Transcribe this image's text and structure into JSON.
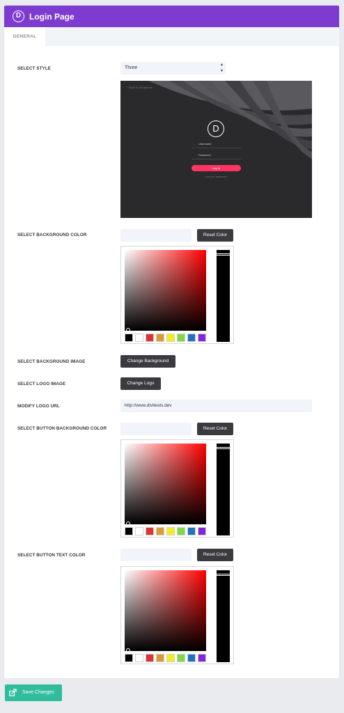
{
  "header": {
    "logo_letter": "D",
    "title": "Login Page"
  },
  "tabs": [
    {
      "label": "GENERAL",
      "active": true
    }
  ],
  "style_section": {
    "label": "SELECT STYLE",
    "selected": "Three",
    "preview": {
      "back_link": "← Back to Wordpress",
      "logo_letter": "D",
      "username_label": "Username",
      "password_label": "Password",
      "login_button": "Log In",
      "forgot_link": "Lost your password?"
    }
  },
  "bg_color": {
    "label": "SELECT BACKGROUND COLOR",
    "reset_label": "Reset Color"
  },
  "bg_image": {
    "label": "SELECT BACKGROUND IMAGE",
    "button_label": "Change Background"
  },
  "logo_image": {
    "label": "SELECT LOGO IMAGE",
    "button_label": "Change Logo"
  },
  "logo_url": {
    "label": "MODIFY LOGO URL",
    "value": "http://www.divitests.dev"
  },
  "btn_bg_color": {
    "label": "SELECT BUTTON BACKGROUND COLOR",
    "reset_label": "Reset Color"
  },
  "btn_text_color": {
    "label": "SELECT BUTTON TEXT COLOR",
    "reset_label": "Reset Color"
  },
  "swatch_colors": [
    "#000000",
    "#ffffff",
    "#dd3333",
    "#dd9933",
    "#eeee22",
    "#81d742",
    "#1e73be",
    "#8224e3"
  ],
  "save": {
    "label": "Save Changes"
  },
  "colors": {
    "accent": "#7e3bd0",
    "save": "#2fbd9c",
    "dark_button": "#3a3a3f",
    "login_pink": "#ff3465"
  }
}
